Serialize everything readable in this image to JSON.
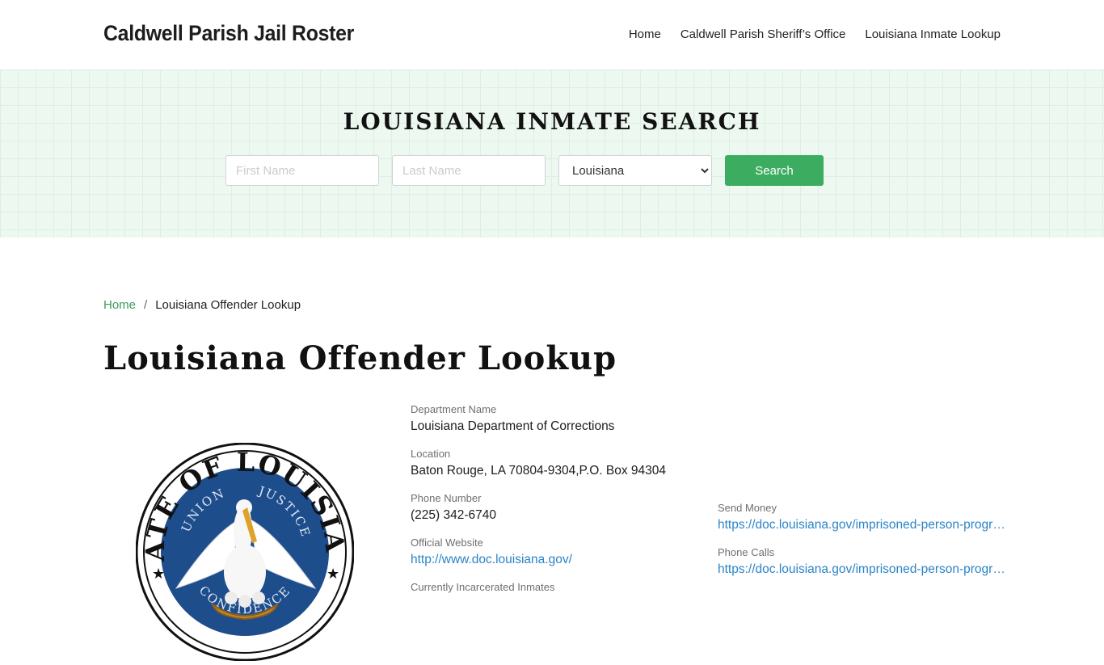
{
  "header": {
    "site_title": "Caldwell Parish Jail Roster",
    "nav": [
      {
        "label": "Home"
      },
      {
        "label": "Caldwell Parish Sheriff’s Office"
      },
      {
        "label": "Louisiana Inmate Lookup"
      }
    ]
  },
  "search": {
    "heading": "LOUISIANA INMATE SEARCH",
    "first_name_placeholder": "First Name",
    "last_name_placeholder": "Last Name",
    "state_selected": "Louisiana",
    "button_label": "Search"
  },
  "breadcrumb": {
    "home": "Home",
    "separator": "/",
    "current": "Louisiana Offender Lookup"
  },
  "page_title": "Louisiana Offender Lookup",
  "seal": {
    "text_outer": "STATE OF LOUISIANA",
    "text_inner_left": "UNION",
    "text_inner_right": "JUSTICE",
    "text_bottom": "CONFIDENCE"
  },
  "details": {
    "department_label": "Department Name",
    "department_value": "Louisiana Department of Corrections",
    "location_label": "Location",
    "location_value": "Baton Rouge, LA 70804-9304,P.O. Box 94304",
    "phone_label": "Phone Number",
    "phone_value": "(225) 342-6740",
    "website_label": "Official Website",
    "website_value": "http://www.doc.louisiana.gov/",
    "inmates_label": "Currently Incarcerated Inmates",
    "send_money_label": "Send Money",
    "send_money_value": "https://doc.louisiana.gov/imprisoned-person-programs-resources/",
    "phone_calls_label": "Phone Calls",
    "phone_calls_value": "https://doc.louisiana.gov/imprisoned-person-programs-resources/"
  },
  "colors": {
    "accent_green": "#3cad60",
    "link_blue": "#2b84c7",
    "seal_blue": "#1e4d8c"
  }
}
